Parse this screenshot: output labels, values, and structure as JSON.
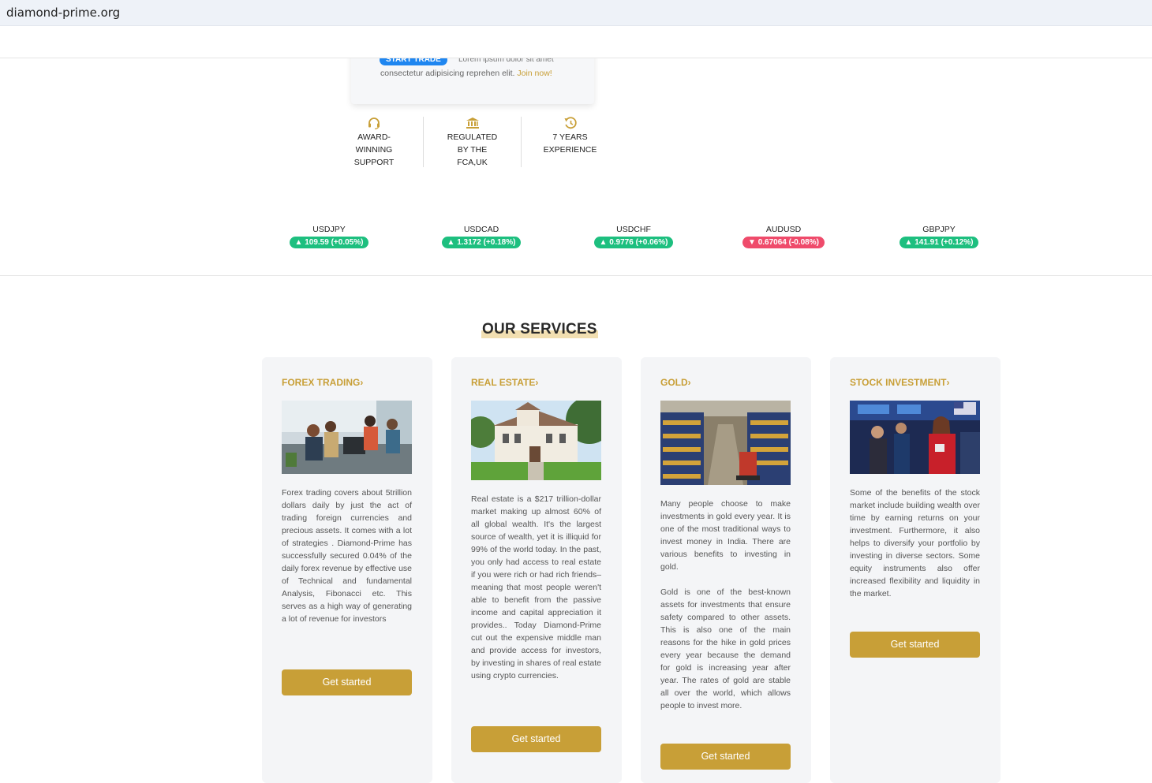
{
  "browser": {
    "url": "diamond-prime.org"
  },
  "hero": {
    "start_trade_label": "START TRADE",
    "line1": "Lorem ipsum dolor sit amet",
    "line2": "consectetur adipisicing reprehen elit.",
    "join_label": "Join now!"
  },
  "features": [
    {
      "icon": "headset-icon",
      "label": "AWARD-\nWINNING\nSUPPORT"
    },
    {
      "icon": "bank-icon",
      "label": "REGULATED\nBY THE\nFCA,UK"
    },
    {
      "icon": "history-icon",
      "label": "7 YEARS\nEXPERIENCE"
    }
  ],
  "tickers": [
    {
      "symbol": "USDJPY",
      "direction": "up",
      "value": "109.59",
      "change": "(+0.05%)"
    },
    {
      "symbol": "USDCAD",
      "direction": "up",
      "value": "1.3172",
      "change": "(+0.18%)"
    },
    {
      "symbol": "USDCHF",
      "direction": "up",
      "value": "0.9776",
      "change": "(+0.06%)"
    },
    {
      "symbol": "AUDUSD",
      "direction": "down",
      "value": "0.67064",
      "change": "(-0.08%)"
    },
    {
      "symbol": "GBPJPY",
      "direction": "up",
      "value": "141.91",
      "change": "(+0.12%)"
    }
  ],
  "services": {
    "title": "OUR SERVICES",
    "cards": [
      {
        "title": "FOREX TRADING",
        "image": "office-team-photo",
        "text": "Forex trading covers about 5trillion dollars daily by just the act of trading foreign currencies and precious assets. It comes with a lot of strategies . Diamond-Prime has successfully secured 0.04% of the daily forex revenue by effective use of Technical and fundamental Analysis, Fibonacci etc. This serves as a high way of generating a lot of revenue for investors",
        "button": "Get started"
      },
      {
        "title": "REAL ESTATE",
        "image": "house-photo",
        "text": "Real estate is a $217 trillion-dollar market making up almost 60% of all global wealth. It's the largest source of wealth, yet it is illiquid for 99% of the world today. In the past, you only had access to real estate if you were rich or had rich friends–meaning that most people weren't able to benefit from the passive income and capital appreciation it provides.. Today Diamond-Prime cut out the expensive middle man and provide access for investors, by investing in shares of real estate using crypto currencies.",
        "button": "Get started"
      },
      {
        "title": "GOLD",
        "image": "gold-vault-photo",
        "text": "Many people choose to make investments in gold every year. It is one of the most traditional ways to invest money in India. There are various benefits to investing in gold.\n\nGold is one of the best-known assets for investments that ensure safety compared to other assets. This is also one of the main reasons for the hike in gold prices every year because the demand for gold is increasing year after year. The rates of gold are stable all over the world, which allows people to invest more.",
        "button": "Get started"
      },
      {
        "title": "STOCK INVESTMENT",
        "image": "stock-exchange-photo",
        "text": "Some of the benefits of the stock market include building wealth over time by earning returns on your investment. Furthermore, it also helps to diversify your portfolio by investing in diverse sectors. Some equity instruments also offer increased flexibility and liquidity in the market.",
        "button": "Get started"
      }
    ]
  },
  "colors": {
    "accent": "#c89f37",
    "blue": "#1f86f0",
    "up": "#1dbf7f",
    "down": "#ef4b6b"
  }
}
